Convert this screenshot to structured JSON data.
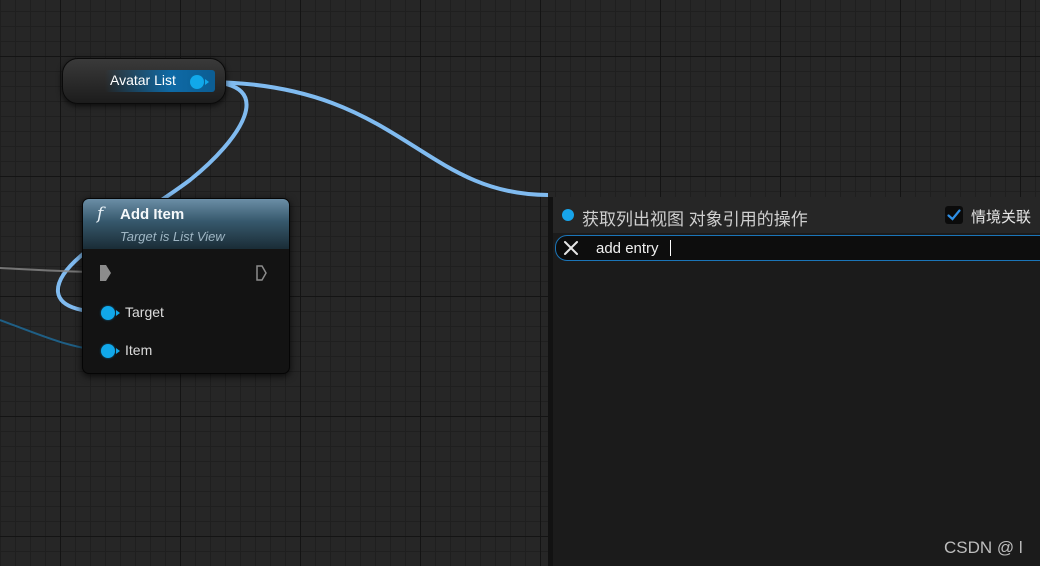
{
  "graph": {
    "variable_node": {
      "label": "Avatar List"
    },
    "function_node": {
      "icon": "function-icon",
      "glyph": "f",
      "title": "Add Item",
      "subtitle": "Target is List View",
      "pins": [
        {
          "label": "Target"
        },
        {
          "label": "Item"
        }
      ]
    },
    "colors": {
      "wire": "#80bbf0",
      "pin": "#11a8ea",
      "accent": "#1b75b8"
    }
  },
  "action_menu": {
    "title": "获取列出视图 对象引用的操作",
    "context_sensitive": {
      "label": "情境关联",
      "checked": true
    },
    "search": {
      "value": "add entry",
      "placeholder": ""
    }
  },
  "watermark": "CSDN @ l"
}
